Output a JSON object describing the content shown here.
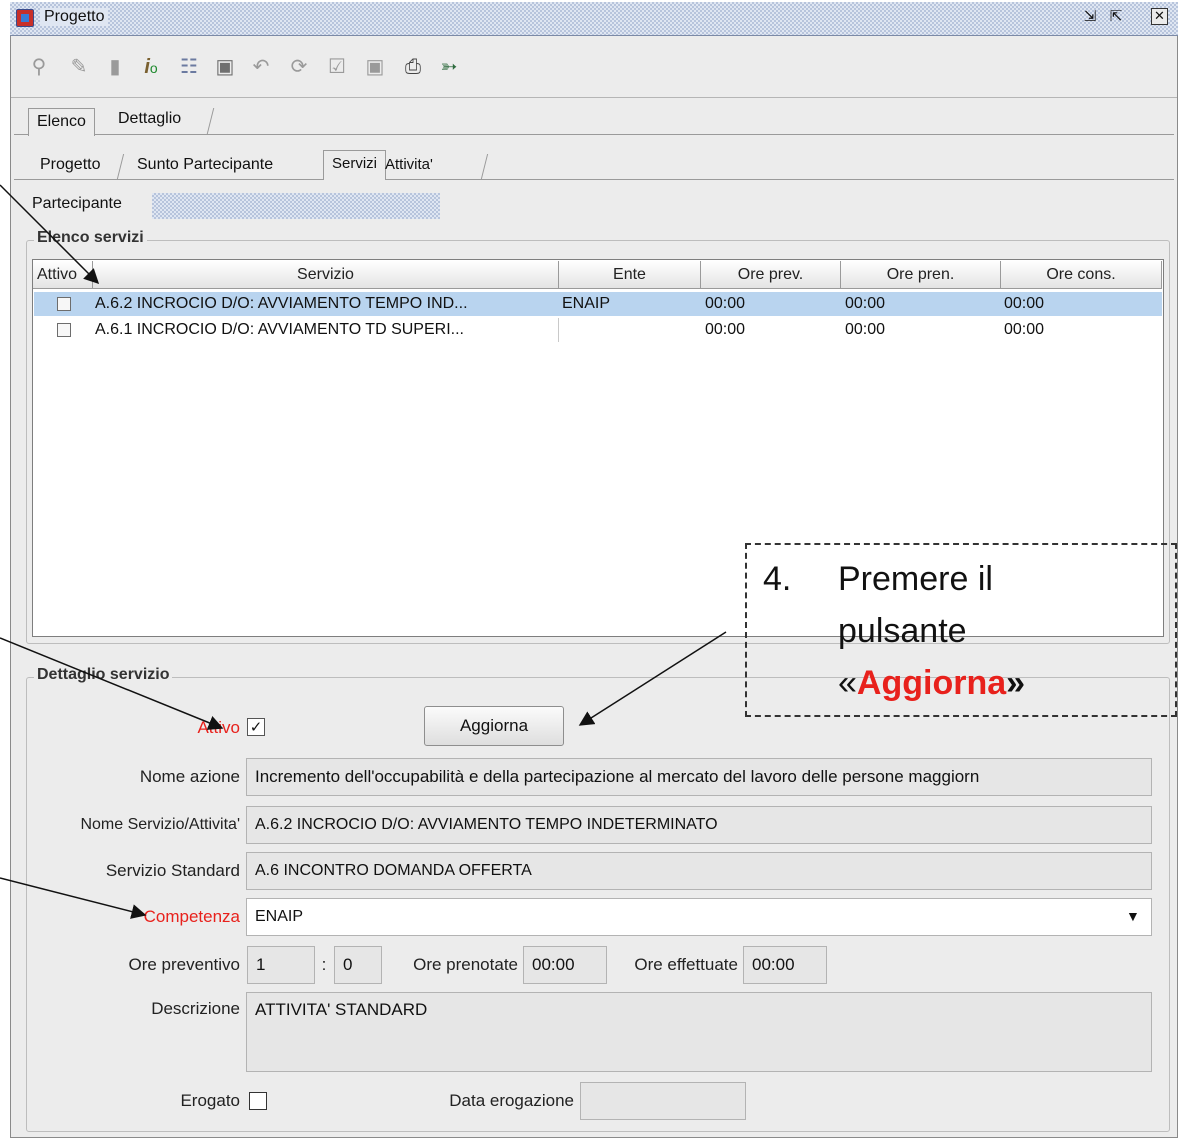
{
  "window": {
    "title": "Progetto"
  },
  "toolbar": {
    "icons": [
      "search-icon",
      "edit-icon",
      "document-icon",
      "info-icon",
      "board-icon",
      "save-icon",
      "undo-icon",
      "refresh-icon",
      "checklist-icon",
      "folder-icon",
      "print-icon",
      "exit-icon"
    ]
  },
  "tabs_top": [
    {
      "label": "Elenco"
    },
    {
      "label": "Dettaglio"
    }
  ],
  "tabs_sub": [
    {
      "label": "Progetto"
    },
    {
      "label": "Sunto Partecipante"
    },
    {
      "label": "Servizi"
    },
    {
      "label": "Attivita'"
    }
  ],
  "partecipante_label": "Partecipante",
  "services_group": {
    "legend": "Elenco servizi",
    "columns": [
      "Attivo",
      "Servizio",
      "Ente",
      "Ore prev.",
      "Ore pren.",
      "Ore cons."
    ],
    "rows": [
      {
        "attivo": false,
        "servizio": "A.6.2 INCROCIO D/O: AVVIAMENTO TEMPO IND...",
        "ente": "ENAIP",
        "ore_prev": "00:00",
        "ore_pren": "00:00",
        "ore_cons": "00:00",
        "selected": true
      },
      {
        "attivo": false,
        "servizio": "A.6.1 INCROCIO D/O: AVVIAMENTO TD SUPERI...",
        "ente": "",
        "ore_prev": "00:00",
        "ore_pren": "00:00",
        "ore_cons": "00:00",
        "selected": false
      }
    ]
  },
  "detail_group": {
    "legend": "Dettaglio servizio",
    "attivo_label": "Attivo",
    "attivo_checked": true,
    "aggiorna_label": "Aggiorna",
    "nome_azione_label": "Nome azione",
    "nome_azione_value": "Incremento  dell'occupabilità e della partecipazione al mercato del lavoro delle persone maggiorn",
    "nome_servizio_label": "Nome Servizio/Attivita'",
    "nome_servizio_value": "A.6.2 INCROCIO D/O: AVVIAMENTO TEMPO INDETERMINATO",
    "servizio_standard_label": "Servizio Standard",
    "servizio_standard_value": "A.6 INCONTRO DOMANDA OFFERTA",
    "competenza_label": "Competenza",
    "competenza_value": "ENAIP",
    "ore_preventivo_label": "Ore preventivo",
    "ore_preventivo_hours": "1",
    "ore_preventivo_sep": ":",
    "ore_preventivo_minutes": "0",
    "ore_prenotate_label": "Ore prenotate",
    "ore_prenotate_value": "00:00",
    "ore_effettuate_label": "Ore effettuate",
    "ore_effettuate_value": "00:00",
    "descrizione_label": "Descrizione",
    "descrizione_value": "ATTIVITA' STANDARD",
    "erogato_label": "Erogato",
    "erogato_checked": false,
    "data_erogazione_label": "Data erogazione",
    "data_erogazione_value": ""
  },
  "annotation": {
    "number": "4.",
    "line1": "Premere il",
    "line2": "pulsante",
    "open_quote": "«",
    "button_name": "Aggiorna",
    "close_quote": "»"
  },
  "colors": {
    "required_label": "#e8211c",
    "selection": "#b9d4ef",
    "annotation_accent": "#e8211c"
  }
}
